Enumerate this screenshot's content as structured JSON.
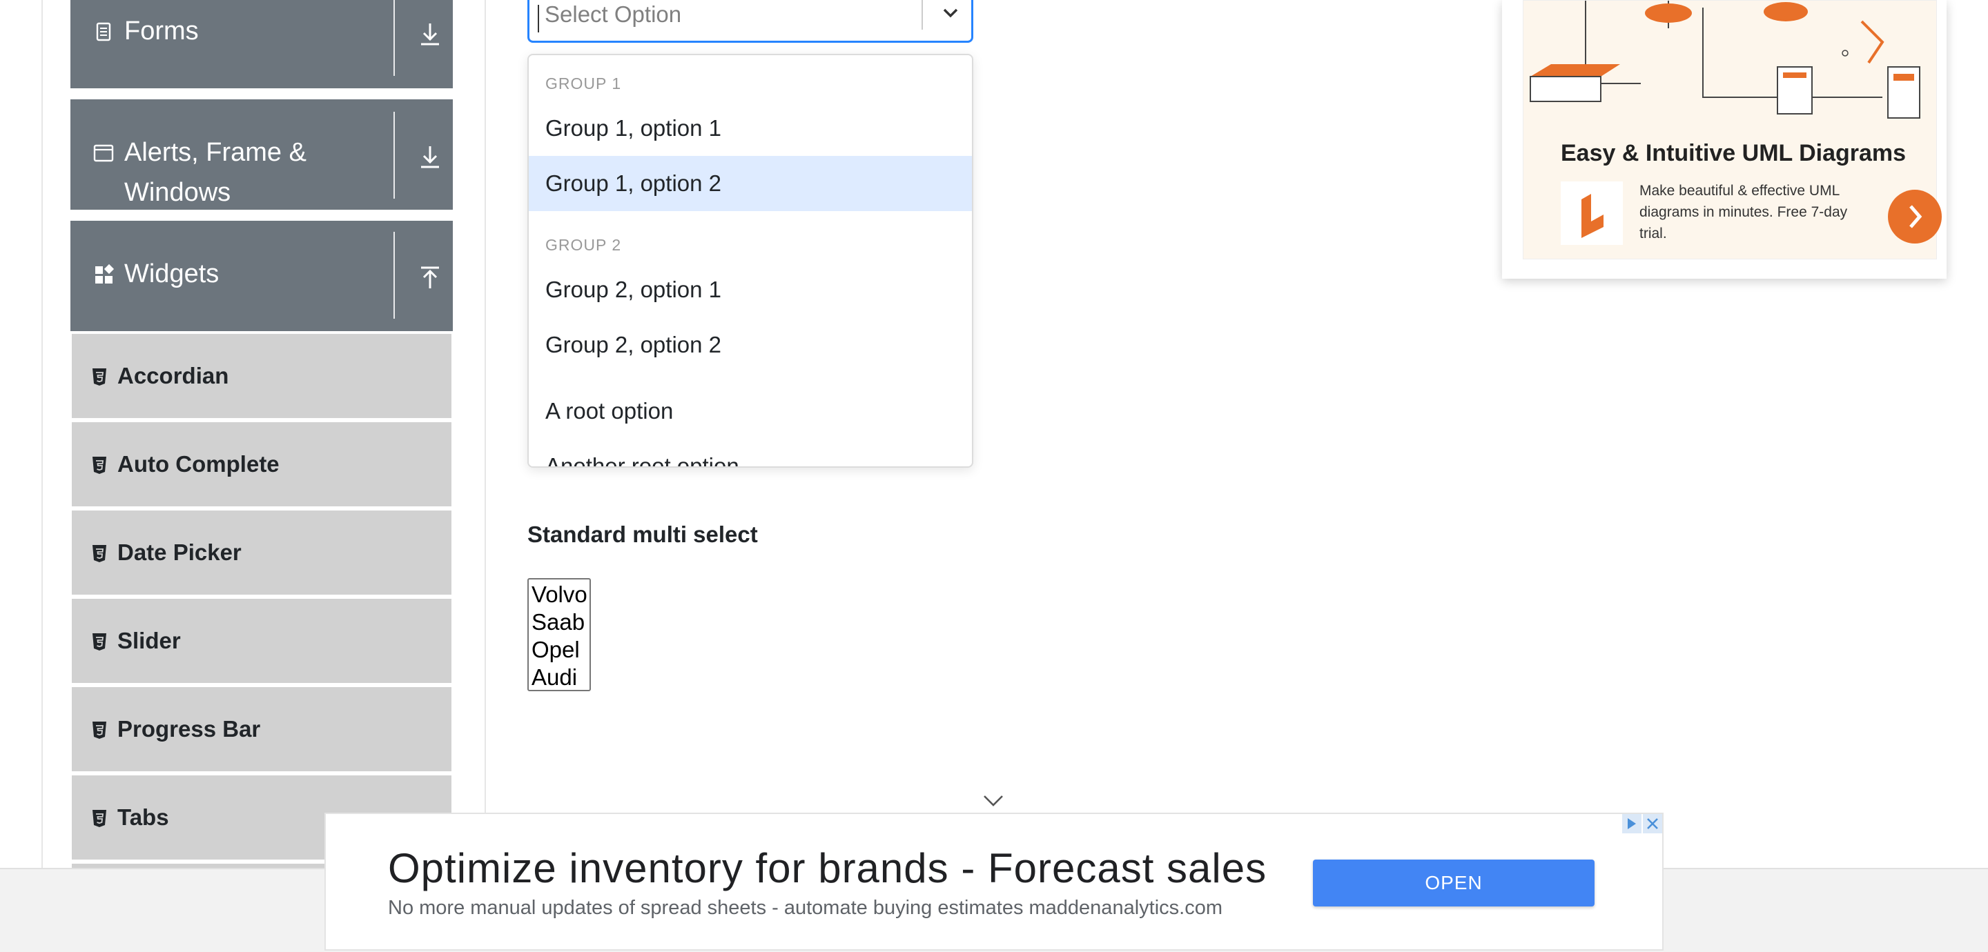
{
  "sidebar": {
    "groups": [
      {
        "label": "Forms",
        "icon": "document-icon",
        "arrow": "download-icon"
      },
      {
        "label_line1": "Alerts, Frame &",
        "label_line2": "Windows",
        "icon": "window-icon",
        "arrow": "download-icon"
      },
      {
        "label": "Widgets",
        "icon": "widgets-icon",
        "arrow": "upload-icon"
      }
    ],
    "items": [
      {
        "label": "Accordian"
      },
      {
        "label": "Auto Complete"
      },
      {
        "label": "Date Picker"
      },
      {
        "label": "Slider"
      },
      {
        "label": "Progress Bar"
      },
      {
        "label": "Tabs"
      }
    ]
  },
  "select": {
    "placeholder": "Select Option",
    "menu": {
      "group1": "GROUP 1",
      "group2": "GROUP 2",
      "options": [
        "Group 1, option 1",
        "Group 1, option 2",
        "Group 2, option 1",
        "Group 2, option 2",
        "A root option",
        "Another root option"
      ],
      "focused_option": "Group 1, option 2"
    }
  },
  "multi_select": {
    "label": "Standard multi select",
    "options": [
      "Volvo",
      "Saab",
      "Opel",
      "Audi"
    ]
  },
  "ad_card": {
    "title": "Easy & Intuitive UML Diagrams",
    "description": "Make beautiful & effective UML diagrams in minutes. Free 7-day trial.",
    "accent_color": "#e8702a"
  },
  "bottom_ad": {
    "title": "Optimize inventory for brands - Forecast sales",
    "subtitle": "No more manual updates of spread sheets - automate buying estimates maddenanalytics.com",
    "button": "OPEN",
    "button_color": "#4285f4"
  },
  "colors": {
    "sidebar_group_bg": "#6c757d",
    "sidebar_item_bg": "#d1d1d1",
    "select_focus_border": "#2684ff",
    "option_focus_bg": "#deebff"
  }
}
